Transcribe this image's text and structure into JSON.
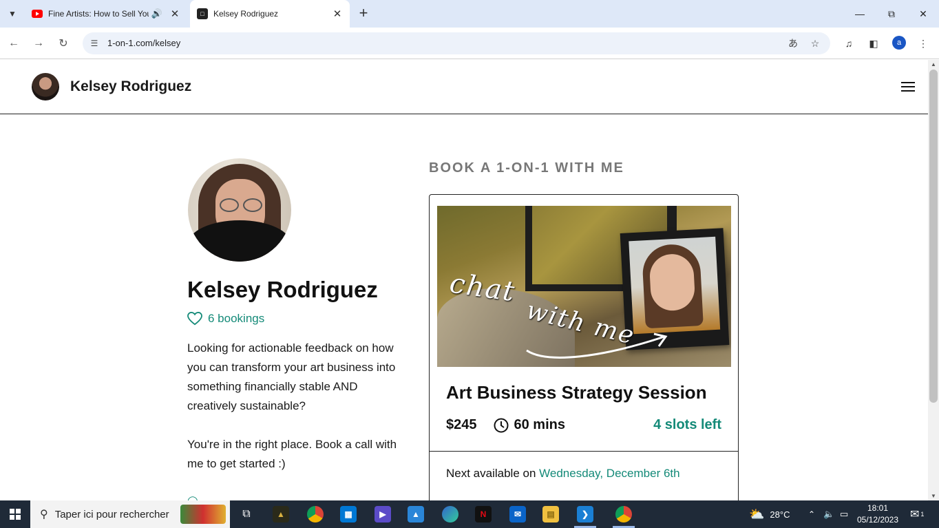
{
  "browser": {
    "tabs": [
      {
        "title": "Fine Artists: How to Sell You",
        "active": false,
        "audio": true
      },
      {
        "title": "Kelsey Rodriguez",
        "active": true,
        "audio": false
      }
    ],
    "url": "1-on-1.com/kelsey",
    "profile_initial": "a"
  },
  "header": {
    "name": "Kelsey Rodriguez"
  },
  "profile": {
    "name": "Kelsey Rodriguez",
    "bookings": "6 bookings",
    "bio": [
      "Looking for actionable feedback on how you can transform your art business into something financially stable AND creatively sustainable?",
      "You're in the right place. Book a call with me to get started :)"
    ]
  },
  "booking": {
    "heading": "BOOK A 1-ON-1 WITH ME",
    "card": {
      "image_text_1": "chat",
      "image_text_2": "with me",
      "title": "Art Business Strategy Session",
      "price": "$245",
      "duration": "60 mins",
      "slots": "4 slots left",
      "next_label": "Next available on",
      "next_date": "Wednesday, December 6th"
    }
  },
  "taskbar": {
    "search_placeholder": "Taper ici pour rechercher",
    "weather": "28°C",
    "time": "18:01",
    "date": "05/12/2023",
    "notifications": "1"
  },
  "colors": {
    "accent": "#148a78",
    "heading_gray": "#777777",
    "tabstrip": "#dee8f8",
    "taskbar": "#1f2a38"
  }
}
